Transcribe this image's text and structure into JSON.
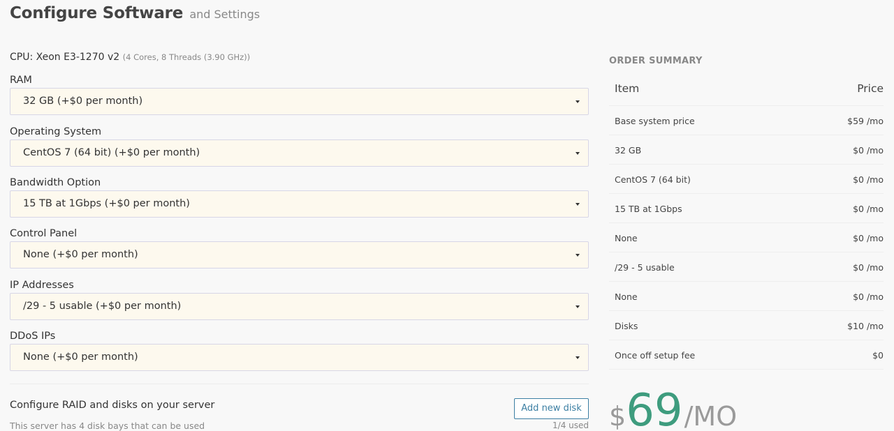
{
  "header": {
    "title": "Configure Software",
    "subtitle": "and Settings"
  },
  "cpu": {
    "label": "CPU: Xeon E3-1270 v2",
    "spec": "(4 Cores, 8 Threads (3.90 GHz))"
  },
  "fields": [
    {
      "label": "RAM",
      "value": "32 GB (+$0 per month)"
    },
    {
      "label": "Operating System",
      "value": "CentOS 7 (64 bit) (+$0 per month)"
    },
    {
      "label": "Bandwidth Option",
      "value": "15 TB at 1Gbps (+$0 per month)"
    },
    {
      "label": "Control Panel",
      "value": "None (+$0 per month)"
    },
    {
      "label": "IP Addresses",
      "value": "/29 - 5 usable (+$0 per month)"
    },
    {
      "label": "DDoS IPs",
      "value": "None (+$0 per month)"
    }
  ],
  "raid": {
    "title": "Configure RAID and disks on your server",
    "subtitle": "This server has 4 disk bays that can be used",
    "add_button": "Add new disk",
    "count": "1/4 used"
  },
  "summary": {
    "heading": "ORDER SUMMARY",
    "col_item": "Item",
    "col_price": "Price",
    "rows": [
      {
        "item": "Base system price",
        "price": "$59 /mo"
      },
      {
        "item": "32 GB",
        "price": "$0 /mo"
      },
      {
        "item": "CentOS 7 (64 bit)",
        "price": "$0 /mo"
      },
      {
        "item": "15 TB at 1Gbps",
        "price": "$0 /mo"
      },
      {
        "item": "None",
        "price": "$0 /mo"
      },
      {
        "item": "/29 - 5 usable",
        "price": "$0 /mo"
      },
      {
        "item": "None",
        "price": "$0 /mo"
      },
      {
        "item": "Disks",
        "price": "$10 /mo"
      },
      {
        "item": "Once off setup fee",
        "price": "$0"
      }
    ],
    "total": {
      "currency": "$",
      "amount": "69",
      "period": "/MO"
    }
  },
  "colors": {
    "accent_green": "#3e9c7e",
    "button_blue": "#3c7fa3",
    "select_bg": "#fdf9ee"
  }
}
